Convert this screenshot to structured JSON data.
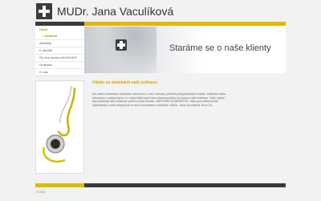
{
  "site": {
    "title": "MUDr. Jana Vaculíková"
  },
  "nav": {
    "items": [
      {
        "label": "Úvod",
        "active": true
      },
      {
        "label": "Úvodem",
        "sub": true
      },
      {
        "label": "Aktuality"
      },
      {
        "label": "K úhradě"
      },
      {
        "label": "On-line služby eKOMUNIT"
      },
      {
        "label": "Ordinace"
      },
      {
        "label": "O nás"
      }
    ]
  },
  "banner": {
    "tagline": "Staráme se o naše klienty"
  },
  "content": {
    "welcome": "Vítejte na stránkách naší ordinace.",
    "body": "Na našich stránkách naleznete informace o naší ordinaci, přehled poskytovaných služeb, ordinační dobu, informace o našem týmu a o nejnovější kapli které dokonce kliknu po pravou naší ordinace. Dále nabízí i tam probíhají také možnost využít on-line služeb. ODPOVĚĎ KOMUNITOS. Jako jsou elektronické objednávky a další bezpečné on-line komunikace s lékařem. MUDr. Jana Vaculíková, Brno 10."
  },
  "footer": {
    "copyright": "© 2010"
  },
  "colors": {
    "accent": "#e2b80b",
    "dark": "#3a3a3a",
    "background": "#f2f2f2"
  },
  "icons": {
    "logo": "medical-cross-icon",
    "banner": "medical-cross-icon"
  }
}
